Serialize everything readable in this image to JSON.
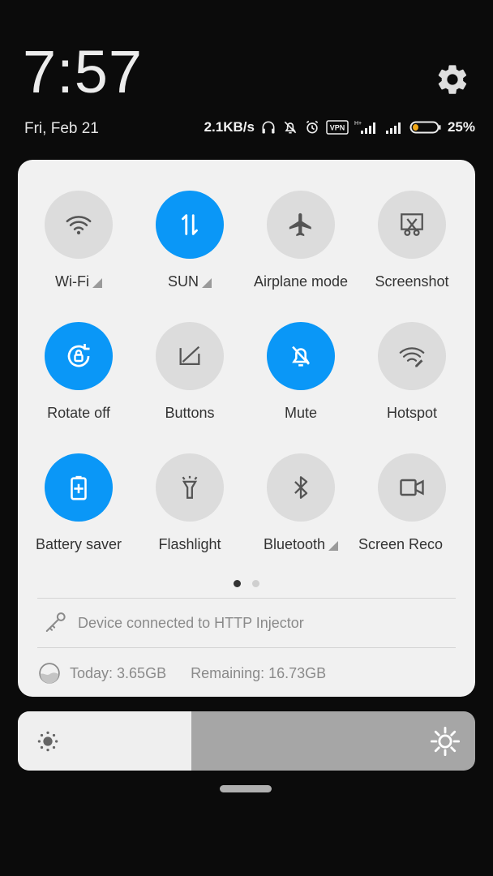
{
  "header": {
    "time": "7:57",
    "date": "Fri, Feb 21",
    "net_speed": "2.1KB/s",
    "vpn_badge": "VPN",
    "battery_percent": "25%",
    "battery_level": 0.25,
    "settings_icon": "gear-icon"
  },
  "tiles": [
    {
      "label": "Wi-Fi",
      "icon": "wifi-icon",
      "active": false,
      "has_arrow": true
    },
    {
      "label": "SUN",
      "icon": "data-transfer-icon",
      "active": true,
      "has_arrow": true
    },
    {
      "label": "Airplane mode",
      "icon": "airplane-icon",
      "active": false,
      "has_arrow": false
    },
    {
      "label": "Screenshot",
      "icon": "scissors-icon",
      "active": false,
      "has_arrow": false
    },
    {
      "label": "Rotate off",
      "icon": "rotate-lock-icon",
      "active": true,
      "has_arrow": false
    },
    {
      "label": "Buttons",
      "icon": "buttons-icon",
      "active": false,
      "has_arrow": false
    },
    {
      "label": "Mute",
      "icon": "bell-off-icon",
      "active": true,
      "has_arrow": false
    },
    {
      "label": "Hotspot",
      "icon": "hotspot-icon",
      "active": false,
      "has_arrow": false
    },
    {
      "label": "Battery saver",
      "icon": "battery-plus-icon",
      "active": true,
      "has_arrow": false
    },
    {
      "label": "Flashlight",
      "icon": "flashlight-icon",
      "active": false,
      "has_arrow": false
    },
    {
      "label": "Bluetooth",
      "icon": "bluetooth-icon",
      "active": false,
      "has_arrow": true
    },
    {
      "label": "Screen Reco",
      "icon": "video-camera-icon",
      "active": false,
      "has_arrow": false
    }
  ],
  "pager": {
    "pages": 2,
    "current": 1
  },
  "vpn_notice": {
    "text": "Device connected to HTTP Injector",
    "icon": "key-icon"
  },
  "data_usage": {
    "today": "Today: 3.65GB",
    "remaining": "Remaining: 16.73GB",
    "icon": "data-gauge-icon"
  },
  "brightness": {
    "level": 0.38
  },
  "colors": {
    "accent": "#0a97f7",
    "panel": "#f1f1f1",
    "tile_inactive": "#dcdcdc",
    "background": "#0b0b0b"
  }
}
